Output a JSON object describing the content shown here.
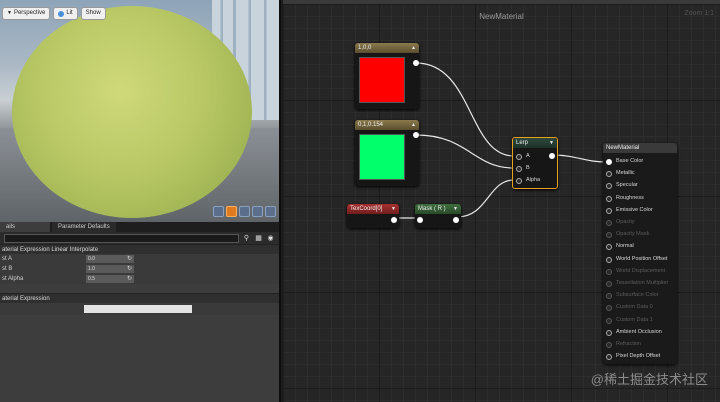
{
  "viewport": {
    "toolbar": {
      "perspective": "Perspective",
      "lit": "Lit",
      "show": "Show"
    }
  },
  "details": {
    "tabs": [
      "ails",
      "Parameter Defaults"
    ],
    "section_lerp": "aterial Expression Linear Interpolate",
    "props": [
      {
        "label": "st A",
        "value": "0.0"
      },
      {
        "label": "st B",
        "value": "1.0"
      },
      {
        "label": "st Alpha",
        "value": "0.5"
      }
    ],
    "section_expr": "aterial Expression"
  },
  "graph": {
    "title": "NewMaterial",
    "zoom": "Zoom 1:1",
    "const_red": {
      "title": "1,0,0",
      "color": "#ff0000"
    },
    "const_green": {
      "title": "0,1,0.154",
      "color": "#00ff6a"
    },
    "texcoord": {
      "title": "TexCoord[0]"
    },
    "mask": {
      "title": "Mask ( R )"
    },
    "lerp": {
      "title": "Lerp",
      "inputs": [
        "A",
        "B",
        "Alpha"
      ]
    },
    "result": {
      "title": "NewMaterial",
      "pins": [
        {
          "label": "Base Color",
          "enabled": true
        },
        {
          "label": "Metallic",
          "enabled": true
        },
        {
          "label": "Specular",
          "enabled": true
        },
        {
          "label": "Roughness",
          "enabled": true
        },
        {
          "label": "Emissive Color",
          "enabled": true
        },
        {
          "label": "Opacity",
          "enabled": false
        },
        {
          "label": "Opacity Mask",
          "enabled": false
        },
        {
          "label": "Normal",
          "enabled": true
        },
        {
          "label": "World Position Offset",
          "enabled": true
        },
        {
          "label": "World Displacement",
          "enabled": false
        },
        {
          "label": "Tessellation Multiplier",
          "enabled": false
        },
        {
          "label": "Subsurface Color",
          "enabled": false
        },
        {
          "label": "Custom Data 0",
          "enabled": false
        },
        {
          "label": "Custom Data 1",
          "enabled": false
        },
        {
          "label": "Ambient Occlusion",
          "enabled": true
        },
        {
          "label": "Refraction",
          "enabled": false
        },
        {
          "label": "Pixel Depth Offset",
          "enabled": true
        }
      ]
    }
  },
  "watermark": "@稀土掘金技术社区"
}
